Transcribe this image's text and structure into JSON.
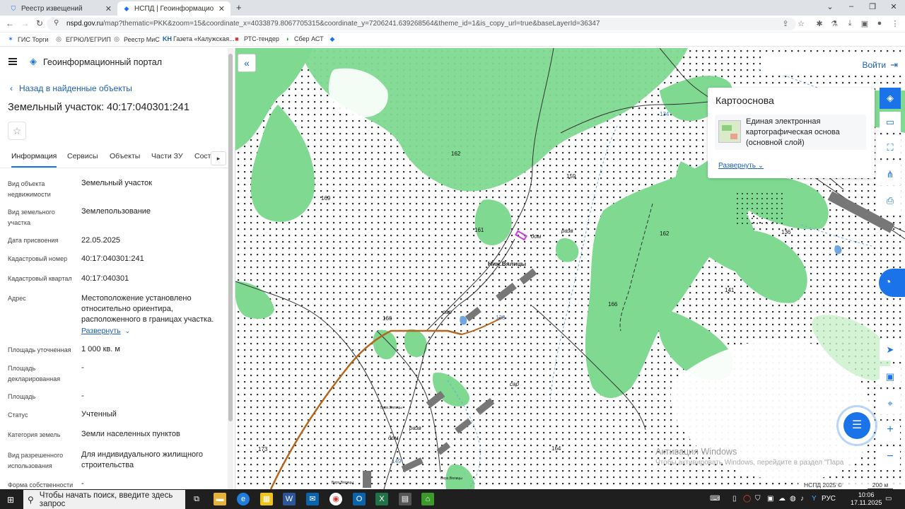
{
  "browser": {
    "tabs": [
      {
        "title": "Реестр извещений",
        "active": false
      },
      {
        "title": "НСПД | Геоинформационный п",
        "active": true
      }
    ],
    "new_tab": "+",
    "url_host": "nspd.gov.ru",
    "url_rest": "/map?thematic=PKK&zoom=15&coordinate_x=4033879.8067705315&coordinate_y=7206241.639268564&theme_id=1&is_copy_url=true&baseLayerId=36347",
    "bookmarks": [
      "ГИС Торги",
      "ЕГРЮЛ/ЕГРИП",
      "Реестр МиС",
      "Газета «Калужская...",
      "РТС-тендер",
      "Сбер АСТ"
    ]
  },
  "app": {
    "portal_title": "Геоинформационный портал",
    "back_link": "Назад в найденные объекты",
    "object_title": "Земельный участок: 40:17:040301:241",
    "tabs": [
      "Информация",
      "Сервисы",
      "Объекты",
      "Части ЗУ",
      "Соста"
    ],
    "properties": [
      {
        "label": "Вид объекта недвижимости",
        "value": "Земельный участок"
      },
      {
        "label": "Вид земельного участка",
        "value": "Землепользование"
      },
      {
        "label": "Дата присвоения",
        "value": "22.05.2025"
      },
      {
        "label": "Кадастровый номер",
        "value": "40:17:040301:241"
      },
      {
        "label": "Кадастровый квартал",
        "value": "40:17:040301"
      },
      {
        "label": "Адрес",
        "value": "Местоположение установлено относительно ориентира, расположенного в границах участка."
      },
      {
        "label": "Площадь уточненная",
        "value": "1 000 кв. м"
      },
      {
        "label": "Площадь декларированная",
        "value": "-"
      },
      {
        "label": "Площадь",
        "value": "-"
      },
      {
        "label": "Статус",
        "value": "Учтенный"
      },
      {
        "label": "Категория земель",
        "value": "Земли населенных пунктов"
      },
      {
        "label": "Вид разрешенного использования",
        "value": "Для индивидуального жилищного строительства"
      },
      {
        "label": "Форма собственности",
        "value": "-"
      }
    ],
    "address_expand": "Развернуть"
  },
  "map": {
    "login": "Войти",
    "basemap_title": "Картооснова",
    "basemap_name": "Единая электронная картографическая основа (основной слой)",
    "basemap_expand": "Развернуть",
    "village_label": "Ниж.Вялицы",
    "labels": [
      "162",
      "159",
      "169",
      "161",
      "дом",
      "разв",
      "162",
      "136",
      "134",
      "141",
      "166",
      "сар",
      "166",
      "138",
      "сар",
      "173",
      "149",
      "разв",
      "дом",
      "164",
      "Верх.Вялицы",
      "Верх.Вялицы",
      "Верх.Вялицы"
    ],
    "activation_title": "Активация Windows",
    "activation_text": "Чтобы активировать Windows, перейдите в раздел \"Пара",
    "copyright": "НСПД 2025 ©",
    "scale": "200 м"
  },
  "taskbar": {
    "search_placeholder": "Чтобы начать поиск, введите здесь запрос",
    "language": "РУС",
    "time": "10:06",
    "date": "17.11.2025"
  },
  "colors": {
    "accent": "#1a73e8",
    "link": "#1a5fb4",
    "forest": "#7fd991",
    "parcel": "#d13adf"
  }
}
